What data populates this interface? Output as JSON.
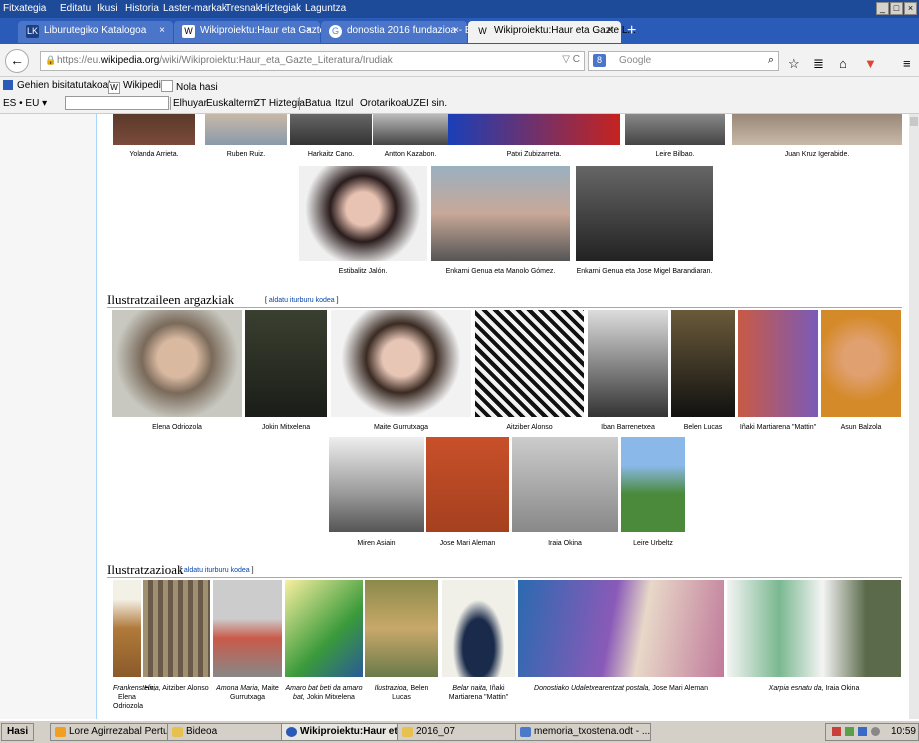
{
  "menubar": {
    "items": [
      "Fitxategia",
      "Editatu",
      "Ikusi",
      "Historia",
      "Laster-markak",
      "Tresnak",
      "Hiztegiak",
      "Laguntza"
    ],
    "window_buttons": [
      "_",
      "□",
      "×"
    ]
  },
  "tabs": [
    {
      "title": "Liburutegiko Katalogoa",
      "fav": "LK",
      "close": "×",
      "fav_color": "#1b3f86"
    },
    {
      "title": "Wikiproiektu:Haur eta Gazte L...",
      "fav": "W",
      "close": "×",
      "fav_color": "#ffffff"
    },
    {
      "title": "donostia 2016 fundazioa - Bu...",
      "fav": "G",
      "close": "×",
      "fav_color": "#ffffff"
    },
    {
      "title": "Wikiproiektu:Haur eta Gazte L...",
      "fav": "W",
      "close": "×",
      "fav_color": "#ffffff"
    }
  ],
  "newtab": "+",
  "nav": {
    "back": "←",
    "forward": "→",
    "url_prefix": "https://eu.",
    "url_host": "wikipedia.org",
    "url_path": "/wiki/Wikiproiektu:Haur_eta_Gazte_Literatura/Irudiak",
    "url_right": "▽ C",
    "search_engine_icon": "8",
    "search_placeholder": "Google",
    "search_icon": "⌕",
    "toolbar_icons": [
      "☆",
      "≣",
      "⌂",
      "▼",
      "≡"
    ]
  },
  "bookmarks": [
    "Gehien bisitatutakoak",
    "Wikipedia",
    "Nola hasi"
  ],
  "gtrans": {
    "lang": "ES • EU",
    "lang_arrow": "▾",
    "input_value": "",
    "links": [
      "Elhuyar",
      "Euskalterm",
      "ZT Hiztegia",
      "Batua",
      "Itzul",
      "Orotarikoa",
      "UZEI sin."
    ]
  },
  "gallery1": {
    "row1": [
      "Yolanda Arrieta.",
      "Ruben Ruiz.",
      "Harkaitz Cano.",
      "Antton Kazabon.",
      "Patxi Zubizarreta.",
      "Leire Bilbao.",
      "Juan Kruz Igerabide."
    ],
    "row2": [
      "Estibalitz Jalón.",
      "Enkarni Genua eta Manolo Gómez.",
      "Enkarni Genua eta Jose Migel Barandiaran."
    ]
  },
  "section_illustrators": {
    "title": "Ilustratzaileen argazkiak",
    "edit_open": "[ ",
    "edit_label": "aldatu iturburu kodea",
    "edit_close": " ]",
    "row1": [
      "Elena Odriozola",
      "Jokin Mitxelena",
      "Maite Gurrutxaga",
      "Aitziber Alonso",
      "Iban Barrenetxea",
      "Belen Lucas",
      "Iñaki Martiarena \"Mattin\"",
      "Asun Balzola"
    ],
    "row2": [
      "Miren Asiain",
      "Jose Mari Aleman",
      "Iraia Okina",
      "Leire Urbeltz"
    ]
  },
  "section_illustrations": {
    "title": "Ilustratzazioak",
    "edit_open": "[ ",
    "edit_label": "aldatu iturburu kodea",
    "edit_close": " ]",
    "captions": [
      {
        "title": "Frankenstein,",
        "author": "Elena Odriozola"
      },
      {
        "title": "Hiria,",
        "author": "Aitziber Alonso"
      },
      {
        "title": "Amona Maria,",
        "author": "Maite Gurrutxaga"
      },
      {
        "title": "Amaro bat beti da amaro bat,",
        "author": "Jokin Mitxelena"
      },
      {
        "title": "Ilustrazioa,",
        "author": "Belen Lucas"
      },
      {
        "title": "Belar naita,",
        "author": "Iñaki Martiarena \"Mattin\""
      },
      {
        "title": "Donostiako Udaletxearentzat postala,",
        "author": "Jose Mari Aleman"
      },
      {
        "title": "Xarpia esnatu da,",
        "author": "Iraia Okina"
      }
    ]
  },
  "taskbar": {
    "start": "Hasi",
    "items": [
      "Lore Agirrezabal Pertusa...",
      "Bideoa",
      "Wikiproiektu:Haur et...",
      "2016_07",
      "memoria_txostena.odt - ..."
    ],
    "clock": "10:59"
  }
}
